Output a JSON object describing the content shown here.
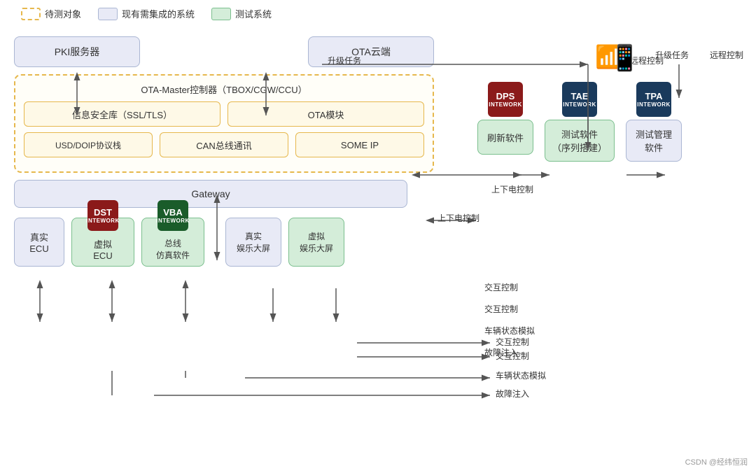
{
  "legend": {
    "item1": "待测对象",
    "item2": "现有需集成的系统",
    "item3": "测试系统"
  },
  "left": {
    "pki": "PKI服务器",
    "ota_cloud": "OTA云端",
    "ota_master_label": "OTA-Master控制器（TBOX/CGW/CCU）",
    "ssl": "信息安全库（SSL/TLS）",
    "ota_module": "OTA模块",
    "usd": "USD/DOIP协议栈",
    "can": "CAN总线通讯",
    "someip": "SOME IP",
    "gateway": "Gateway",
    "real_ecu": "真实\nECU",
    "virtual_ecu": "虚拟\nECU",
    "bus_sim": "总线\n仿真软件",
    "real_entertainment": "真实\n娱乐大屏",
    "virtual_entertainment": "虚拟\n娱乐大屏"
  },
  "right": {
    "refresh_software": "刷新软件",
    "test_software_line1": "测试软件",
    "test_software_line2": "（序列搭建）",
    "test_mgmt_line1": "测试管理",
    "test_mgmt_line2": "软件",
    "logos": {
      "dps": "DPS",
      "tae": "TAE",
      "tpa": "TPA",
      "dst": "DST",
      "vba": "VBA"
    },
    "network_label": "INTEWORK"
  },
  "arrows": {
    "upgrade_task": "升级任务",
    "remote_control": "远程控制",
    "up_down_control": "上下电控制",
    "interaction_control1": "交互控制",
    "interaction_control2": "交互控制",
    "vehicle_state_sim": "车辆状态模拟",
    "fault_injection": "故障注入"
  },
  "watermark": "CSDN @经纬恒润"
}
